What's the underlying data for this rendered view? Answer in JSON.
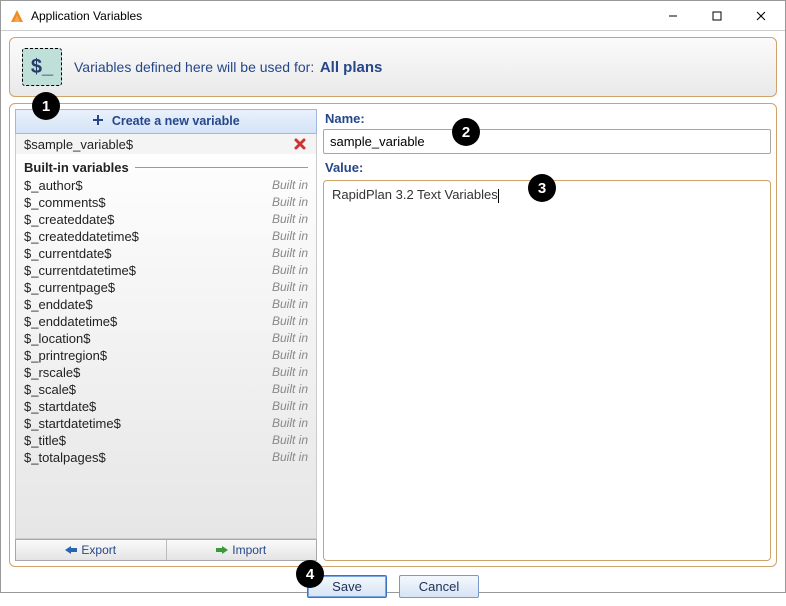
{
  "title": "Application Variables",
  "banner": {
    "icon_text": "$_",
    "text": "Variables defined here will be used for:",
    "scope": "All plans"
  },
  "left": {
    "create_label": "Create a new variable",
    "user_vars": [
      {
        "name": "$sample_variable$"
      }
    ],
    "builtin_header": "Built-in variables",
    "builtin_tag": "Built in",
    "builtin_vars": [
      "$_author$",
      "$_comments$",
      "$_createddate$",
      "$_createddatetime$",
      "$_currentdate$",
      "$_currentdatetime$",
      "$_currentpage$",
      "$_enddate$",
      "$_enddatetime$",
      "$_location$",
      "$_printregion$",
      "$_rscale$",
      "$_scale$",
      "$_startdate$",
      "$_startdatetime$",
      "$_title$",
      "$_totalpages$"
    ],
    "export_label": "Export",
    "import_label": "Import"
  },
  "right": {
    "name_label": "Name:",
    "name_value": "sample_variable",
    "value_label": "Value:",
    "value_value": "RapidPlan 3.2 Text Variables"
  },
  "buttons": {
    "save": "Save",
    "cancel": "Cancel"
  },
  "callouts": [
    "1",
    "2",
    "3",
    "4"
  ]
}
